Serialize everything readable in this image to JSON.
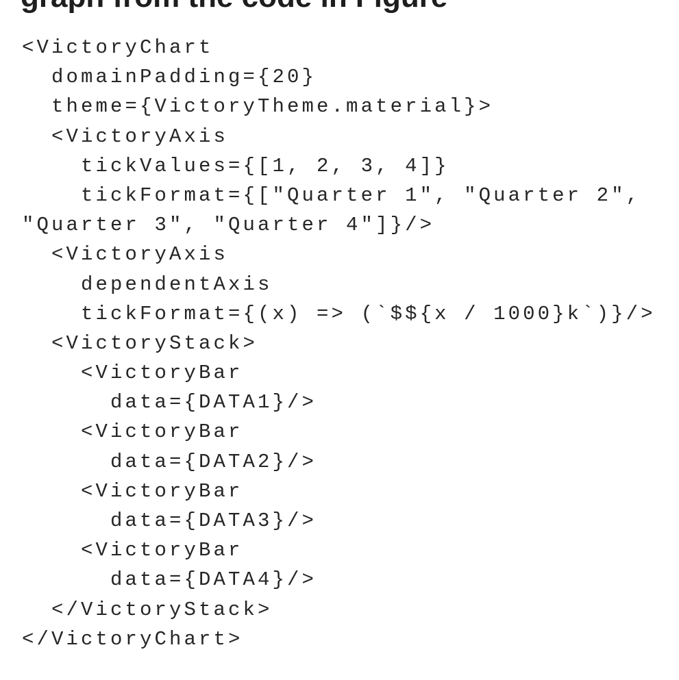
{
  "heading": {
    "text": "graph from the code in Figure"
  },
  "code": {
    "lines": [
      "<VictoryChart",
      "  domainPadding={20}",
      "  theme={VictoryTheme.material}>",
      "  <VictoryAxis",
      "    tickValues={[1, 2, 3, 4]}",
      "    tickFormat={[\"Quarter 1\", \"Quarter 2\",",
      "\"Quarter 3\", \"Quarter 4\"]}/>",
      "  <VictoryAxis",
      "    dependentAxis",
      "    tickFormat={(x) => (`$${x / 1000}k`)}/>",
      "  <VictoryStack>",
      "    <VictoryBar",
      "      data={DATA1}/>",
      "    <VictoryBar",
      "      data={DATA2}/>",
      "    <VictoryBar",
      "      data={DATA3}/>",
      "    <VictoryBar",
      "      data={DATA4}/>",
      "  </VictoryStack>",
      "</VictoryChart>"
    ]
  }
}
